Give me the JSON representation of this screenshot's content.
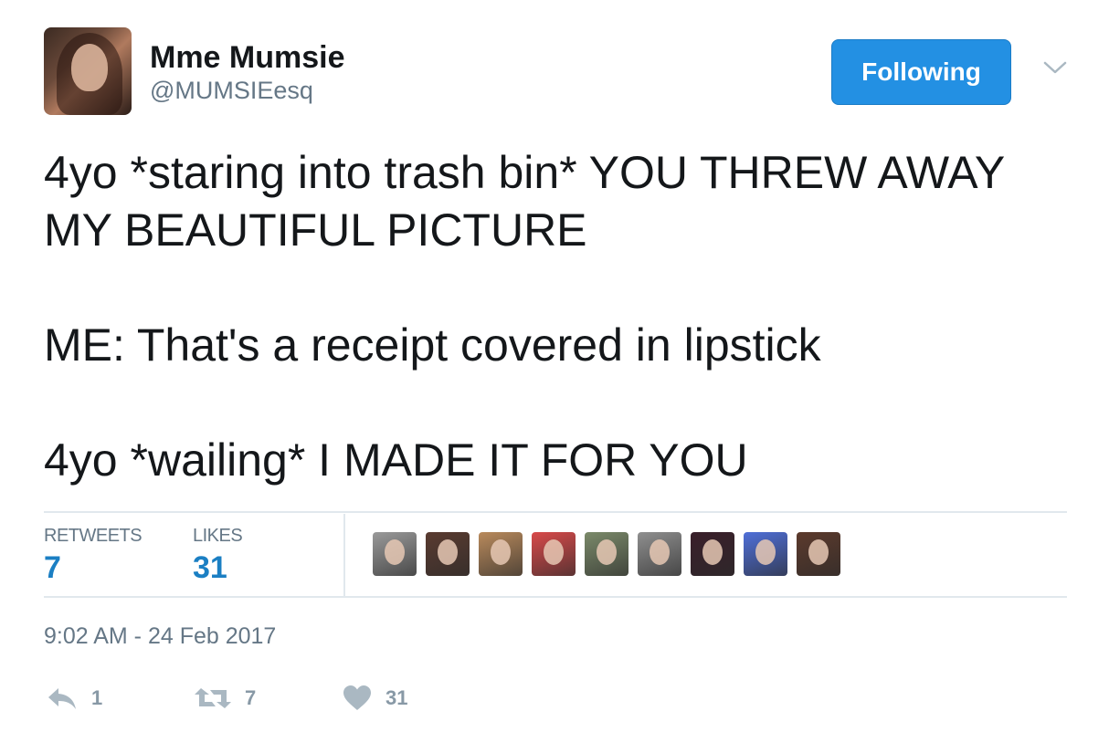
{
  "author": {
    "display_name": "Mme Mumsie",
    "handle": "@MUMSIEesq",
    "avatar_icon": "profile-photo"
  },
  "header": {
    "follow_button_label": "Following",
    "more_icon": "chevron-down-icon"
  },
  "tweet": {
    "text": "4yo *staring into trash bin* YOU THREW AWAY MY BEAUTIFUL PICTURE\n\nME: That's a receipt covered in lipstick\n\n4yo *wailing* I MADE IT FOR YOU"
  },
  "stats": {
    "retweets_label": "RETWEETS",
    "retweets_count": "7",
    "likes_label": "LIKES",
    "likes_count": "31"
  },
  "likers": [
    {
      "avatar_icon": "user-avatar",
      "color": "#9a9a9a"
    },
    {
      "avatar_icon": "user-avatar",
      "color": "#5a3b30"
    },
    {
      "avatar_icon": "user-avatar",
      "color": "#b98a5c"
    },
    {
      "avatar_icon": "user-avatar",
      "color": "#d84a4a"
    },
    {
      "avatar_icon": "user-avatar",
      "color": "#7b8a6a"
    },
    {
      "avatar_icon": "user-avatar",
      "color": "#8f8f8f"
    },
    {
      "avatar_icon": "user-avatar",
      "color": "#3a1f2a"
    },
    {
      "avatar_icon": "user-avatar",
      "color": "#4f6fd8"
    },
    {
      "avatar_icon": "user-avatar",
      "color": "#5c3a2c"
    }
  ],
  "timestamp": "9:02 AM - 24 Feb 2017",
  "actions": {
    "reply_icon": "reply-icon",
    "reply_count": "1",
    "retweet_icon": "retweet-icon",
    "retweet_count": "7",
    "like_icon": "heart-icon",
    "like_count": "31"
  },
  "colors": {
    "accent": "#2390e3",
    "stat_value": "#1b7fc3",
    "secondary_text": "#657786",
    "action_gray": "#aab8c2",
    "divider": "#e1e8ed"
  }
}
